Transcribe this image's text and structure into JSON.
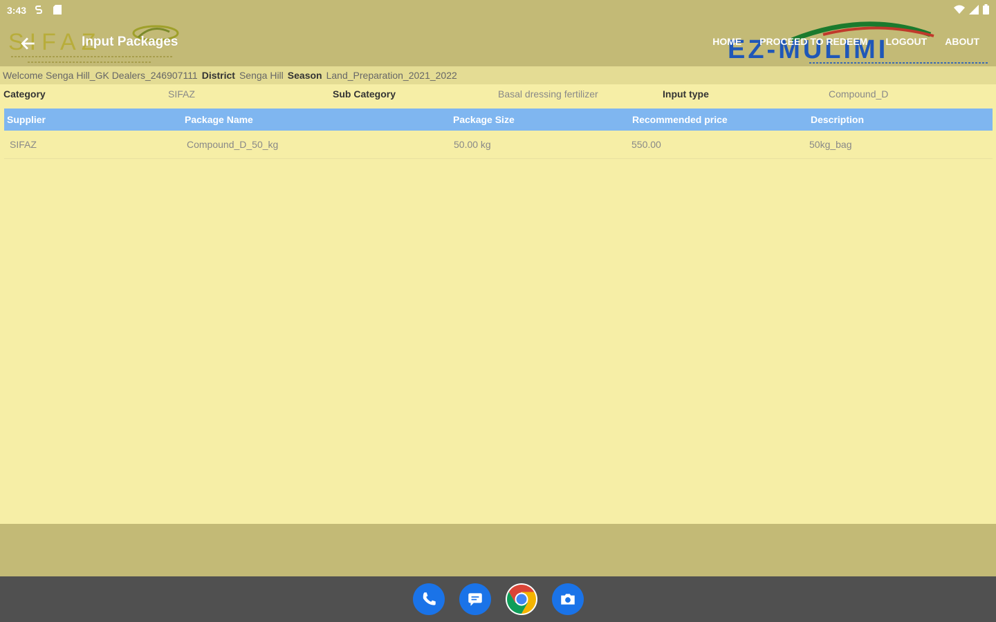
{
  "status_bar": {
    "time": "3:43",
    "icons": [
      "signal-s-icon",
      "sd-card-icon",
      "wifi-icon",
      "cell-signal-icon",
      "battery-icon"
    ]
  },
  "app_bar": {
    "title": "Input Packages",
    "logo_left_text": "SIFAZ",
    "logo_right_text": "EZ-MULIMI",
    "nav": {
      "home": "HOME",
      "proceed": "PROCEED TO REDEEM",
      "logout": "LOGOUT",
      "about": "ABOUT"
    }
  },
  "welcome": {
    "text": "Welcome Senga Hill_GK Dealers_246907111",
    "district_label": "District",
    "district_value": "Senga Hill",
    "season_label": "Season",
    "season_value": "Land_Preparation_2021_2022"
  },
  "filters": {
    "category_label": "Category",
    "category_value": "SIFAZ",
    "sub_category_label": "Sub Category",
    "sub_category_value": "Basal dressing fertilizer",
    "input_type_label": "Input type",
    "input_type_value": "Compound_D"
  },
  "table": {
    "headers": [
      "Supplier",
      "Package Name",
      "Package Size",
      "Recommended price",
      "Description"
    ],
    "rows": [
      [
        "SIFAZ",
        "Compound_D_50_kg",
        "50.00 kg",
        "550.00",
        "50kg_bag"
      ]
    ]
  },
  "dock": [
    "phone-icon",
    "messages-icon",
    "chrome-icon",
    "camera-icon"
  ],
  "colors": {
    "app_bar": "#c3ba76",
    "background": "#f6eea6",
    "table_header": "#7fb6f0",
    "nav_bar": "#505050"
  }
}
